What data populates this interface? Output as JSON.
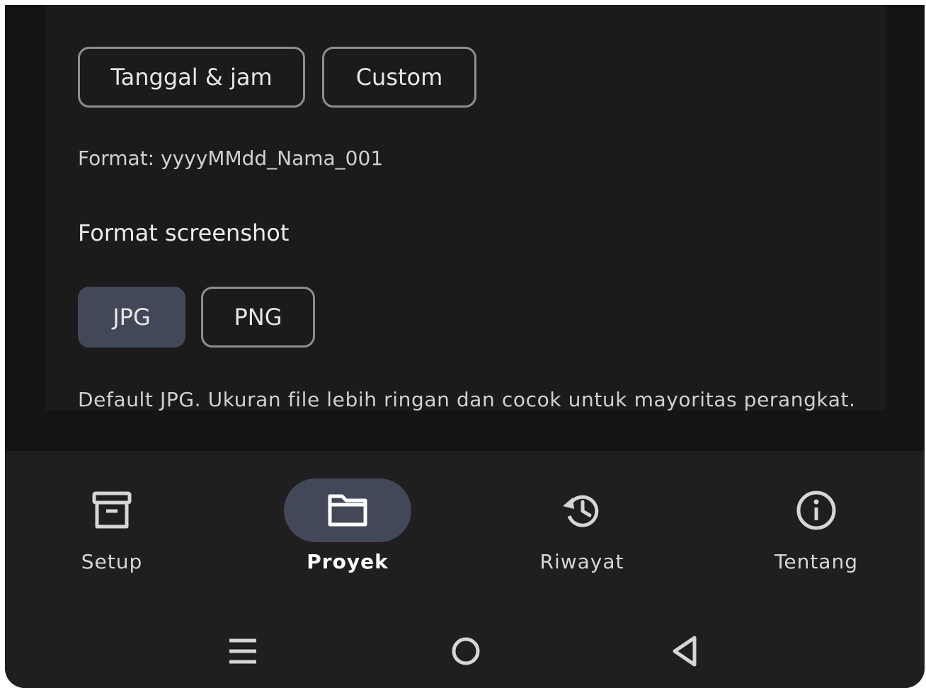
{
  "filename": {
    "options": [
      "Tanggal & jam",
      "Custom"
    ],
    "format_text": "Format: yyyyMMdd_Nama_001"
  },
  "screenshot": {
    "title": "Format screenshot",
    "options": [
      "JPG",
      "PNG"
    ],
    "selected": "JPG",
    "description": "Default JPG. Ukuran file lebih ringan dan cocok untuk mayoritas perangkat."
  },
  "nav": {
    "items": [
      {
        "label": "Setup",
        "icon": "archive-icon"
      },
      {
        "label": "Proyek",
        "icon": "folder-icon",
        "active": true
      },
      {
        "label": "Riwayat",
        "icon": "history-icon"
      },
      {
        "label": "Tentang",
        "icon": "info-icon"
      }
    ]
  },
  "system_nav": {
    "buttons": [
      "recents-icon",
      "home-icon",
      "back-icon"
    ]
  },
  "colors": {
    "selected_chip": "#434858",
    "background": "#141414",
    "card": "#1b1b1b"
  }
}
